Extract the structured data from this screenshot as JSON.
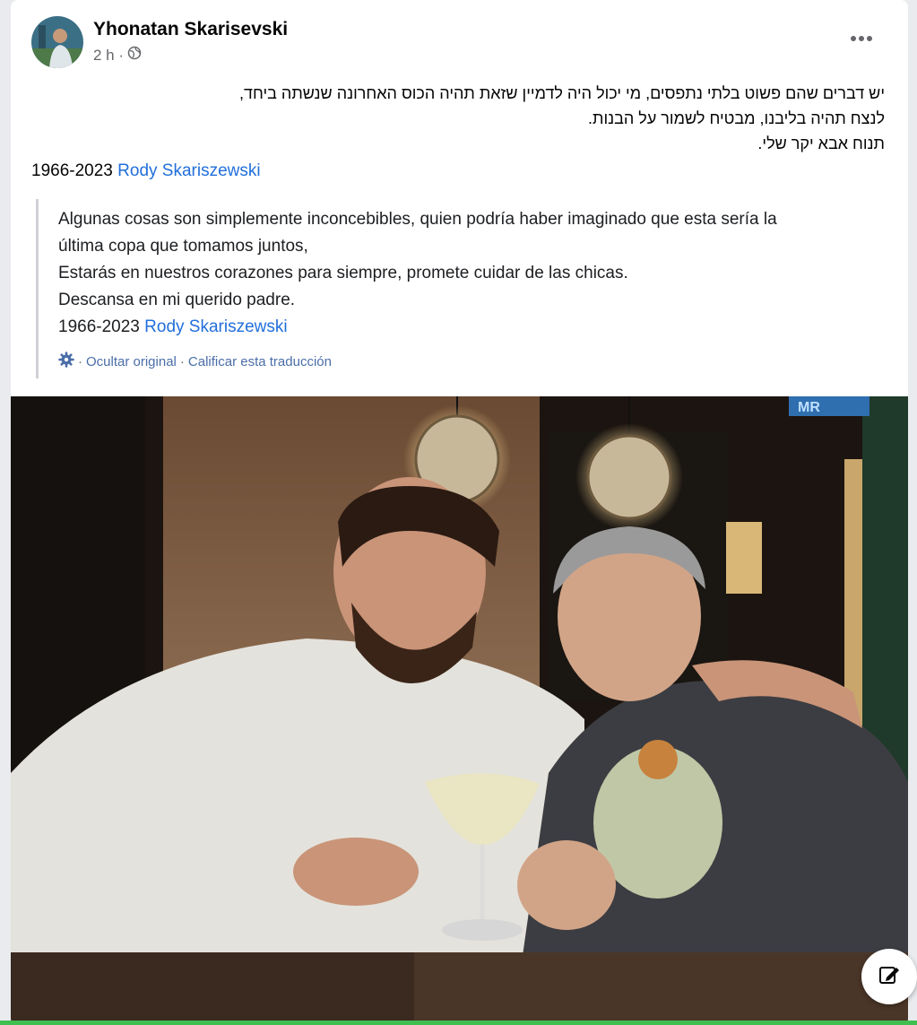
{
  "post": {
    "author": "Yhonatan Skarisevski",
    "time": "2 h ·",
    "privacy_icon": "globe-icon",
    "more_icon": "more-horizontal-icon",
    "hebrew_lines": [
      "יש דברים שהם פשוט בלתי נתפסים, מי יכול היה לדמיין שזאת תהיה הכוס האחרונה שנשתה ביחד,",
      "לנצח תהיה בליבנו, מבטיח לשמור על הבנות.",
      "תנוח אבא יקר שלי."
    ],
    "years": "1966-2023",
    "tagged_name": "Rody Skariszewski"
  },
  "translation": {
    "lines": [
      "Algunas cosas son simplemente inconcebibles, quien podría haber imaginado que esta sería la",
      "última copa que tomamos juntos,",
      "Estarás en nuestros corazones para siempre, promete cuidar de las chicas.",
      "Descansa en mi querido padre."
    ],
    "years": "1966-2023",
    "tagged_name": "Rody Skariszewski",
    "hide_original": "Ocultar original",
    "separator": "·",
    "rate_translation": "Calificar esta traducción",
    "settings_icon": "gear-icon"
  },
  "photo": {
    "sign_text": "MR"
  },
  "colors": {
    "link": "#216fdb",
    "muted": "#65676b",
    "accent_bar": "#3fbf4f"
  }
}
